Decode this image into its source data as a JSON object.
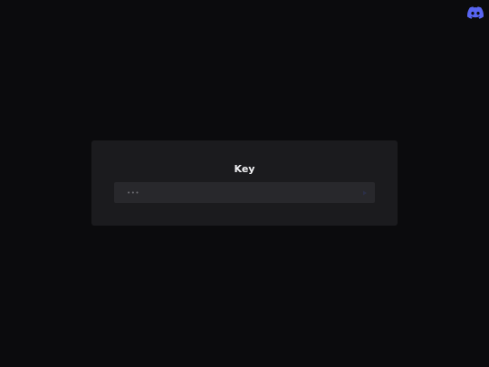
{
  "header": {
    "discord_icon": "discord-icon",
    "discord_color": "#5865F2"
  },
  "dialog": {
    "title": "Key",
    "input": {
      "value": "",
      "placeholder": "•••"
    },
    "submit_icon": "arrow-right-icon",
    "submit_color": "#2b2f47"
  },
  "colors": {
    "background": "#0b0b0d",
    "card": "#1b1b1e",
    "field": "#28282c",
    "title_text": "#f2f2f4"
  }
}
